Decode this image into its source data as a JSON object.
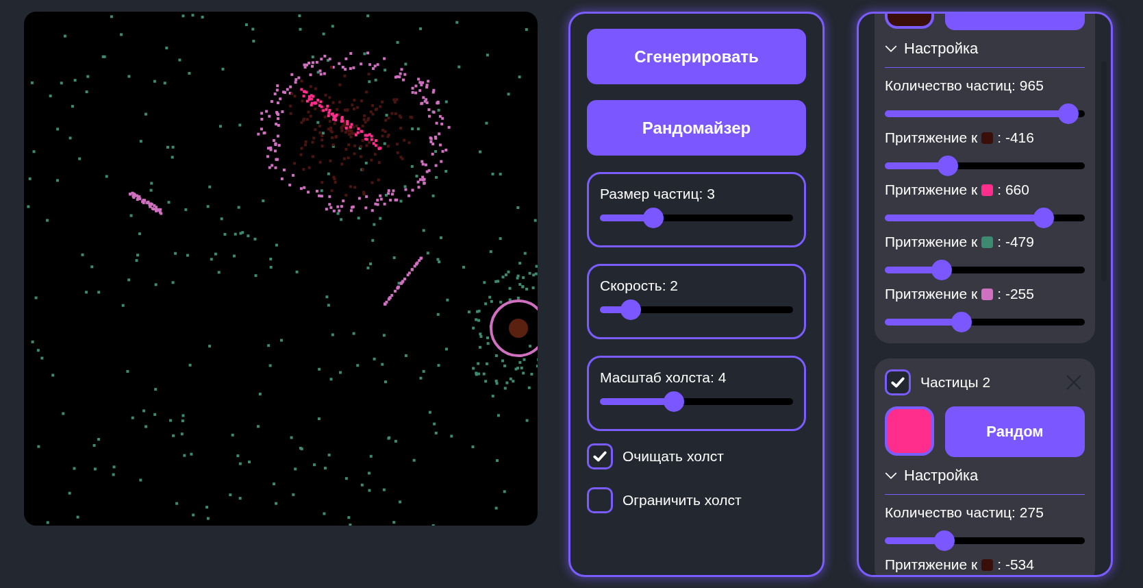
{
  "controls": {
    "buttons": [
      "Сгенерировать",
      "Рандомайзер"
    ],
    "sliders": [
      {
        "label": "Размер частиц: 3",
        "level": 0.25
      },
      {
        "label": "Скорость: 2",
        "level": 0.12
      },
      {
        "label": "Масштаб холста: 4",
        "level": 0.37
      }
    ],
    "checkboxes": [
      {
        "label": "Очищать холст",
        "checked": true
      },
      {
        "label": "Ограничить холст",
        "checked": false
      }
    ]
  },
  "particle_groups": [
    {
      "color": "#3a0f0a",
      "settings": {
        "label": "Настройка",
        "expanded": true
      },
      "count": {
        "label": "Количество частиц: 965",
        "level": 0.965
      },
      "attractions": [
        {
          "prefix": "Притяжение к",
          "color": "#3a0f0a",
          "value": ": -416",
          "level": 0.292
        },
        {
          "prefix": "Притяжение к",
          "color": "#ff2d8c",
          "value": ": 660",
          "level": 0.83
        },
        {
          "prefix": "Притяжение к",
          "color": "#3e8a70",
          "value": ": -479",
          "level": 0.26
        },
        {
          "prefix": "Притяжение к",
          "color": "#d070c0",
          "value": ": -255",
          "level": 0.372
        }
      ]
    },
    {
      "enabled": true,
      "name": "Частицы 2",
      "color": "#ff2d8c",
      "random_button": "Рандом",
      "settings": {
        "label": "Настройка",
        "expanded": true
      },
      "count": {
        "label": "Количество частиц: 275",
        "level": 0.275
      },
      "attractions": [
        {
          "prefix": "Притяжение к",
          "color": "#3a0f0a",
          "value": ": -534"
        }
      ]
    }
  ]
}
